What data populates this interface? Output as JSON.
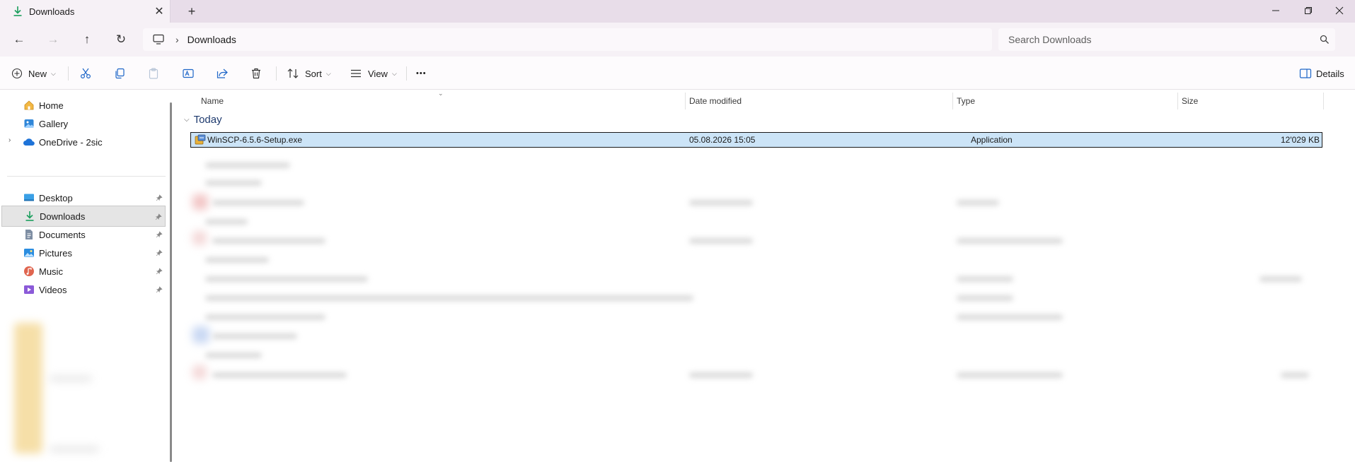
{
  "window": {
    "tab_title": "Downloads",
    "new_tab": "+",
    "minimize": "—",
    "maximize": "❐",
    "close": "✕"
  },
  "nav": {
    "back": "←",
    "forward": "→",
    "up": "↑",
    "refresh": "↻",
    "breadcrumb_separator": "›",
    "breadcrumb": "Downloads",
    "search_placeholder": "Search Downloads"
  },
  "commands": {
    "new": "New",
    "sort": "Sort",
    "view": "View",
    "more": "•••",
    "details": "Details"
  },
  "sidebar": {
    "top_items": [
      {
        "label": "Home",
        "icon": "home-icon"
      },
      {
        "label": "Gallery",
        "icon": "gallery-icon"
      },
      {
        "label": "OneDrive - 2sic",
        "icon": "cloud-icon"
      }
    ],
    "pinned_items": [
      {
        "label": "Desktop",
        "icon": "desktop-icon"
      },
      {
        "label": "Downloads",
        "icon": "download-icon",
        "selected": true
      },
      {
        "label": "Documents",
        "icon": "documents-icon"
      },
      {
        "label": "Pictures",
        "icon": "pictures-icon"
      },
      {
        "label": "Music",
        "icon": "music-icon"
      },
      {
        "label": "Videos",
        "icon": "videos-icon"
      }
    ]
  },
  "columns": {
    "name": "Name",
    "date": "Date modified",
    "type": "Type",
    "size": "Size"
  },
  "group": {
    "label": "Today"
  },
  "files": [
    {
      "name": "WinSCP-6.5.6-Setup.exe",
      "date": "05.08.2026 15:05",
      "type": "Application",
      "size": "12'029 KB",
      "selected": true
    }
  ],
  "colors": {
    "titlebar": "#e8dde9",
    "selection": "#cce4f7",
    "accent_download": "#1a9e5c"
  }
}
